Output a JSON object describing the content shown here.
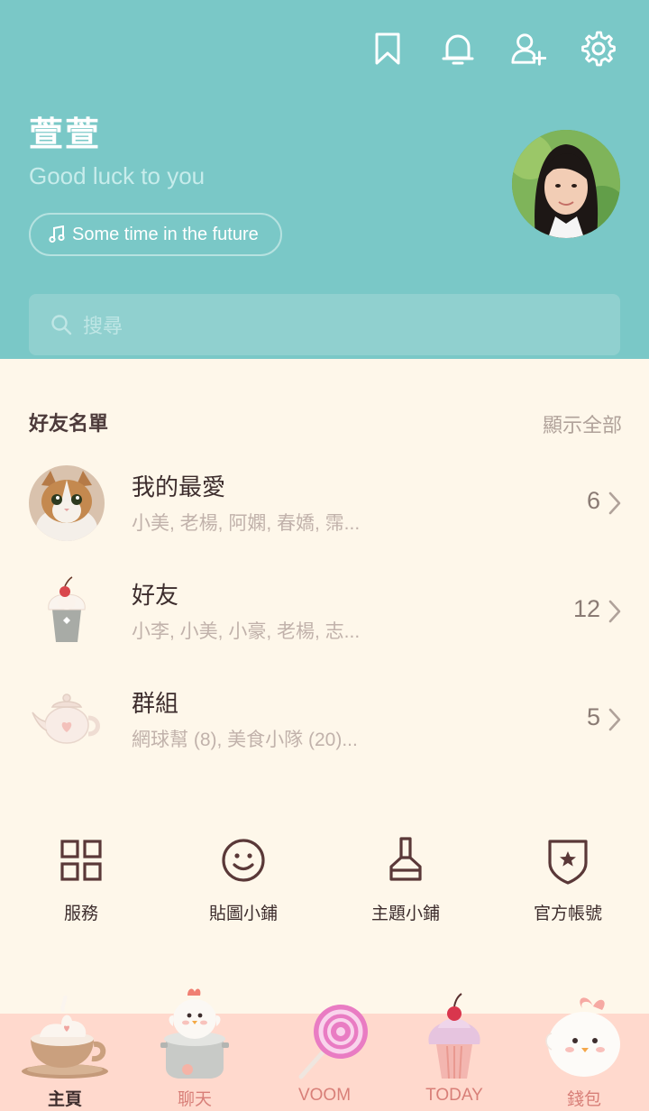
{
  "header": {
    "icons": [
      "bookmark-icon",
      "bell-icon",
      "add-friend-icon",
      "gear-icon"
    ],
    "name": "萱萱",
    "status": "Good luck to you",
    "music": "Some time in the future",
    "search_placeholder": "搜尋",
    "bg_color": "#7ac8c7"
  },
  "friends": {
    "title": "好友名單",
    "show_all": "顯示全部",
    "rows": [
      {
        "title": "我的最愛",
        "sub": "小美, 老楊, 阿嫻, 春嬌, 霈...",
        "count": "6",
        "icon": "cat-avatar"
      },
      {
        "title": "好友",
        "sub": "小李, 小美, 小豪, 老楊, 志...",
        "count": "12",
        "icon": "cupcake-icon"
      },
      {
        "title": "群組",
        "sub": "網球幫 (8), 美食小隊 (20)...",
        "count": "5",
        "icon": "teapot-icon"
      }
    ]
  },
  "shortcuts": [
    {
      "label": "服務",
      "icon": "grid-icon"
    },
    {
      "label": "貼圖小鋪",
      "icon": "smiley-icon"
    },
    {
      "label": "主題小鋪",
      "icon": "brush-icon"
    },
    {
      "label": "官方帳號",
      "icon": "shield-star-icon"
    }
  ],
  "nav": [
    {
      "label": "主頁",
      "icon": "coffee-cup-icon",
      "active": true
    },
    {
      "label": "聊天",
      "icon": "chicken-pot-icon",
      "active": false
    },
    {
      "label": "VOOM",
      "icon": "lollipop-icon",
      "active": false
    },
    {
      "label": "TODAY",
      "icon": "cupcake-icon",
      "active": false
    },
    {
      "label": "錢包",
      "icon": "chick-icon",
      "active": false
    }
  ]
}
